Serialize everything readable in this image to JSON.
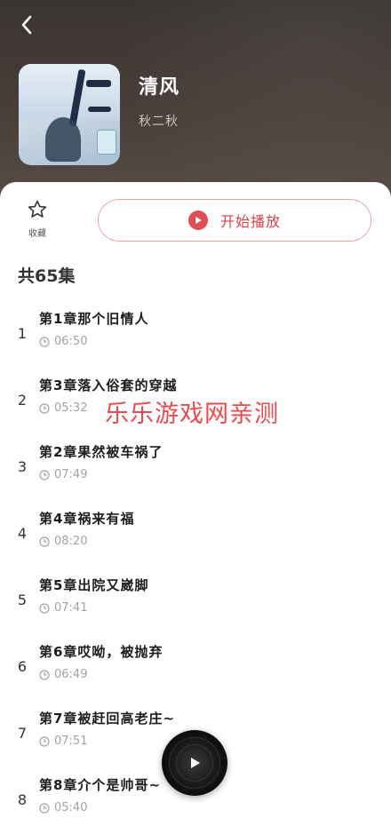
{
  "header": {
    "back_icon": "chevron-left-icon",
    "title": "清风",
    "author": "秋二秋"
  },
  "actions": {
    "favorite_label": "收藏",
    "favorite_icon": "star-outline-icon",
    "play_label": "开始播放",
    "play_icon": "play-circle-icon",
    "accent_color": "#e04f55"
  },
  "episode_count": "共65集",
  "episodes": [
    {
      "num": "1",
      "title": "第1章那个旧情人",
      "duration": "06:50"
    },
    {
      "num": "2",
      "title": "第3章落入俗套的穿越",
      "duration": "05:32"
    },
    {
      "num": "3",
      "title": "第2章果然被车祸了",
      "duration": "07:49"
    },
    {
      "num": "4",
      "title": "第4章祸来有福",
      "duration": "08:20"
    },
    {
      "num": "5",
      "title": "第5章出院又崴脚",
      "duration": "07:41"
    },
    {
      "num": "6",
      "title": "第6章哎呦，被抛弃",
      "duration": "06:49"
    },
    {
      "num": "7",
      "title": "第7章被赶回高老庄~",
      "duration": "07:51"
    },
    {
      "num": "8",
      "title": "第8章介个是帅哥~",
      "duration": "05:40"
    }
  ],
  "watermark": "乐乐游戏网亲测",
  "player": {
    "icon": "play-icon"
  }
}
